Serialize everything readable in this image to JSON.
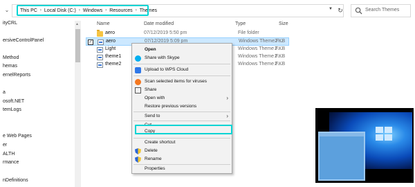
{
  "address": {
    "crumbs": [
      "This PC",
      "Local Disk (C:)",
      "Windows",
      "Resources",
      "Themes"
    ],
    "search_placeholder": "Search Themes"
  },
  "nav": {
    "items": [
      "ityCRL",
      "ersiveControlPanel",
      "Method",
      "hemas",
      "ernelReports",
      "a",
      "osoft.NET",
      "temLogs",
      "e Web Pages",
      "er",
      "ALTH",
      "rmance",
      "nDefinitions"
    ]
  },
  "columns": {
    "name": "Name",
    "date": "Date modified",
    "type": "Type",
    "size": "Size"
  },
  "files": [
    {
      "name": "aero",
      "date": "07/12/2019 5:50 pm",
      "type": "File folder",
      "size": "",
      "icon": "folder-icon",
      "selected": false
    },
    {
      "name": "aero",
      "date": "07/12/2019 5:09 pm",
      "type": "Windows Theme F...",
      "size": "2 KB",
      "icon": "theme-file-icon",
      "selected": true
    },
    {
      "name": "Light",
      "date": "",
      "type": "Windows Theme F...",
      "size": "2 KB",
      "icon": "theme-file-icon",
      "selected": false
    },
    {
      "name": "theme1",
      "date": "",
      "type": "Windows Theme F...",
      "size": "2 KB",
      "icon": "theme-file-icon",
      "selected": false
    },
    {
      "name": "theme2",
      "date": "",
      "type": "Windows Theme F...",
      "size": "2 KB",
      "icon": "theme-file-icon",
      "selected": false
    }
  ],
  "menu": {
    "open": "Open",
    "share_skype": "Share with Skype",
    "upload_wps": "Upload to WPS Cloud",
    "scan": "Scan selected items for viruses",
    "share": "Share",
    "open_with": "Open with",
    "restore": "Restore previous versions",
    "send_to": "Send to",
    "cut": "Cut",
    "copy": "Copy",
    "create_shortcut": "Create shortcut",
    "delete": "Delete",
    "rename": "Rename",
    "properties": "Properties"
  },
  "colors": {
    "highlight": "#00d4d4",
    "selection": "#cce8ff",
    "menu_bg": "#f2f2f2"
  }
}
